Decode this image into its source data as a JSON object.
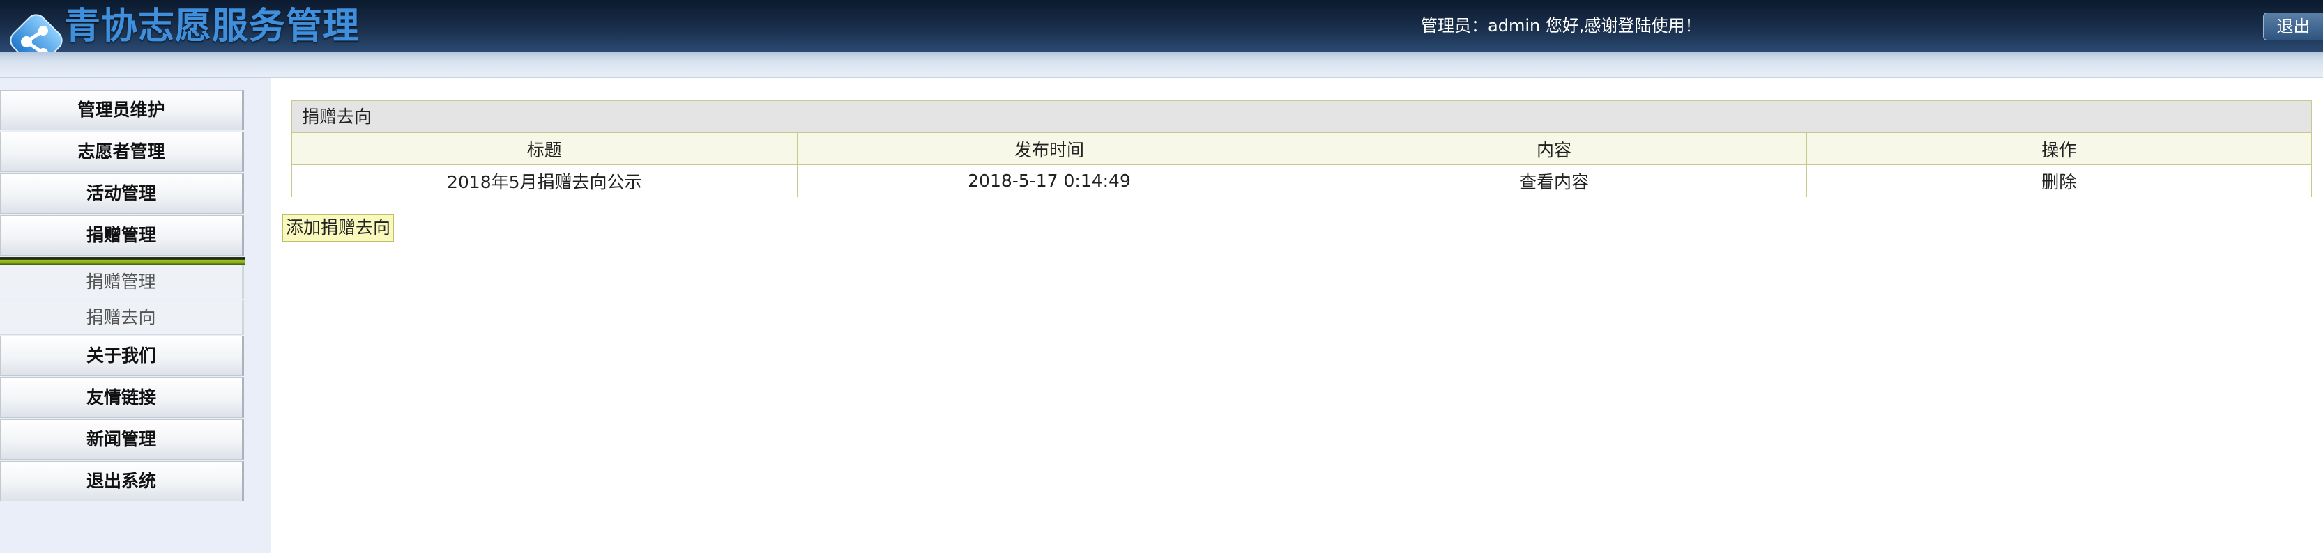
{
  "header": {
    "app_title": "青协志愿服务管理",
    "welcome": "管理员：admin 您好,感谢登陆使用！",
    "logout_label": "退出",
    "logo_icon": "share-node-icon"
  },
  "sidebar": {
    "items": [
      {
        "label": "管理员维护"
      },
      {
        "label": "志愿者管理"
      },
      {
        "label": "活动管理"
      },
      {
        "label": "捐赠管理"
      }
    ],
    "expanded_group": "捐赠管理",
    "subitems": [
      {
        "label": "捐赠管理"
      },
      {
        "label": "捐赠去向"
      }
    ],
    "items_after": [
      {
        "label": "关于我们"
      },
      {
        "label": "友情链接"
      },
      {
        "label": "新闻管理"
      },
      {
        "label": "退出系统"
      }
    ]
  },
  "main": {
    "panel_title": "捐赠去向",
    "columns": [
      "标题",
      "发布时间",
      "内容",
      "操作"
    ],
    "rows": [
      {
        "title": "2018年5月捐赠去向公示",
        "time": "2018-5-17 0:14:49",
        "content": "查看内容",
        "action": "删除"
      }
    ],
    "add_button": "添加捐赠去向"
  },
  "colors": {
    "header_bg": "#1a2f4c",
    "title_blue": "#3f8fdc",
    "table_border": "#c9c98d",
    "table_header_bg": "#f8f8e8",
    "button_bg": "#f9f9bd",
    "menu_accent": "#9ac61b"
  }
}
